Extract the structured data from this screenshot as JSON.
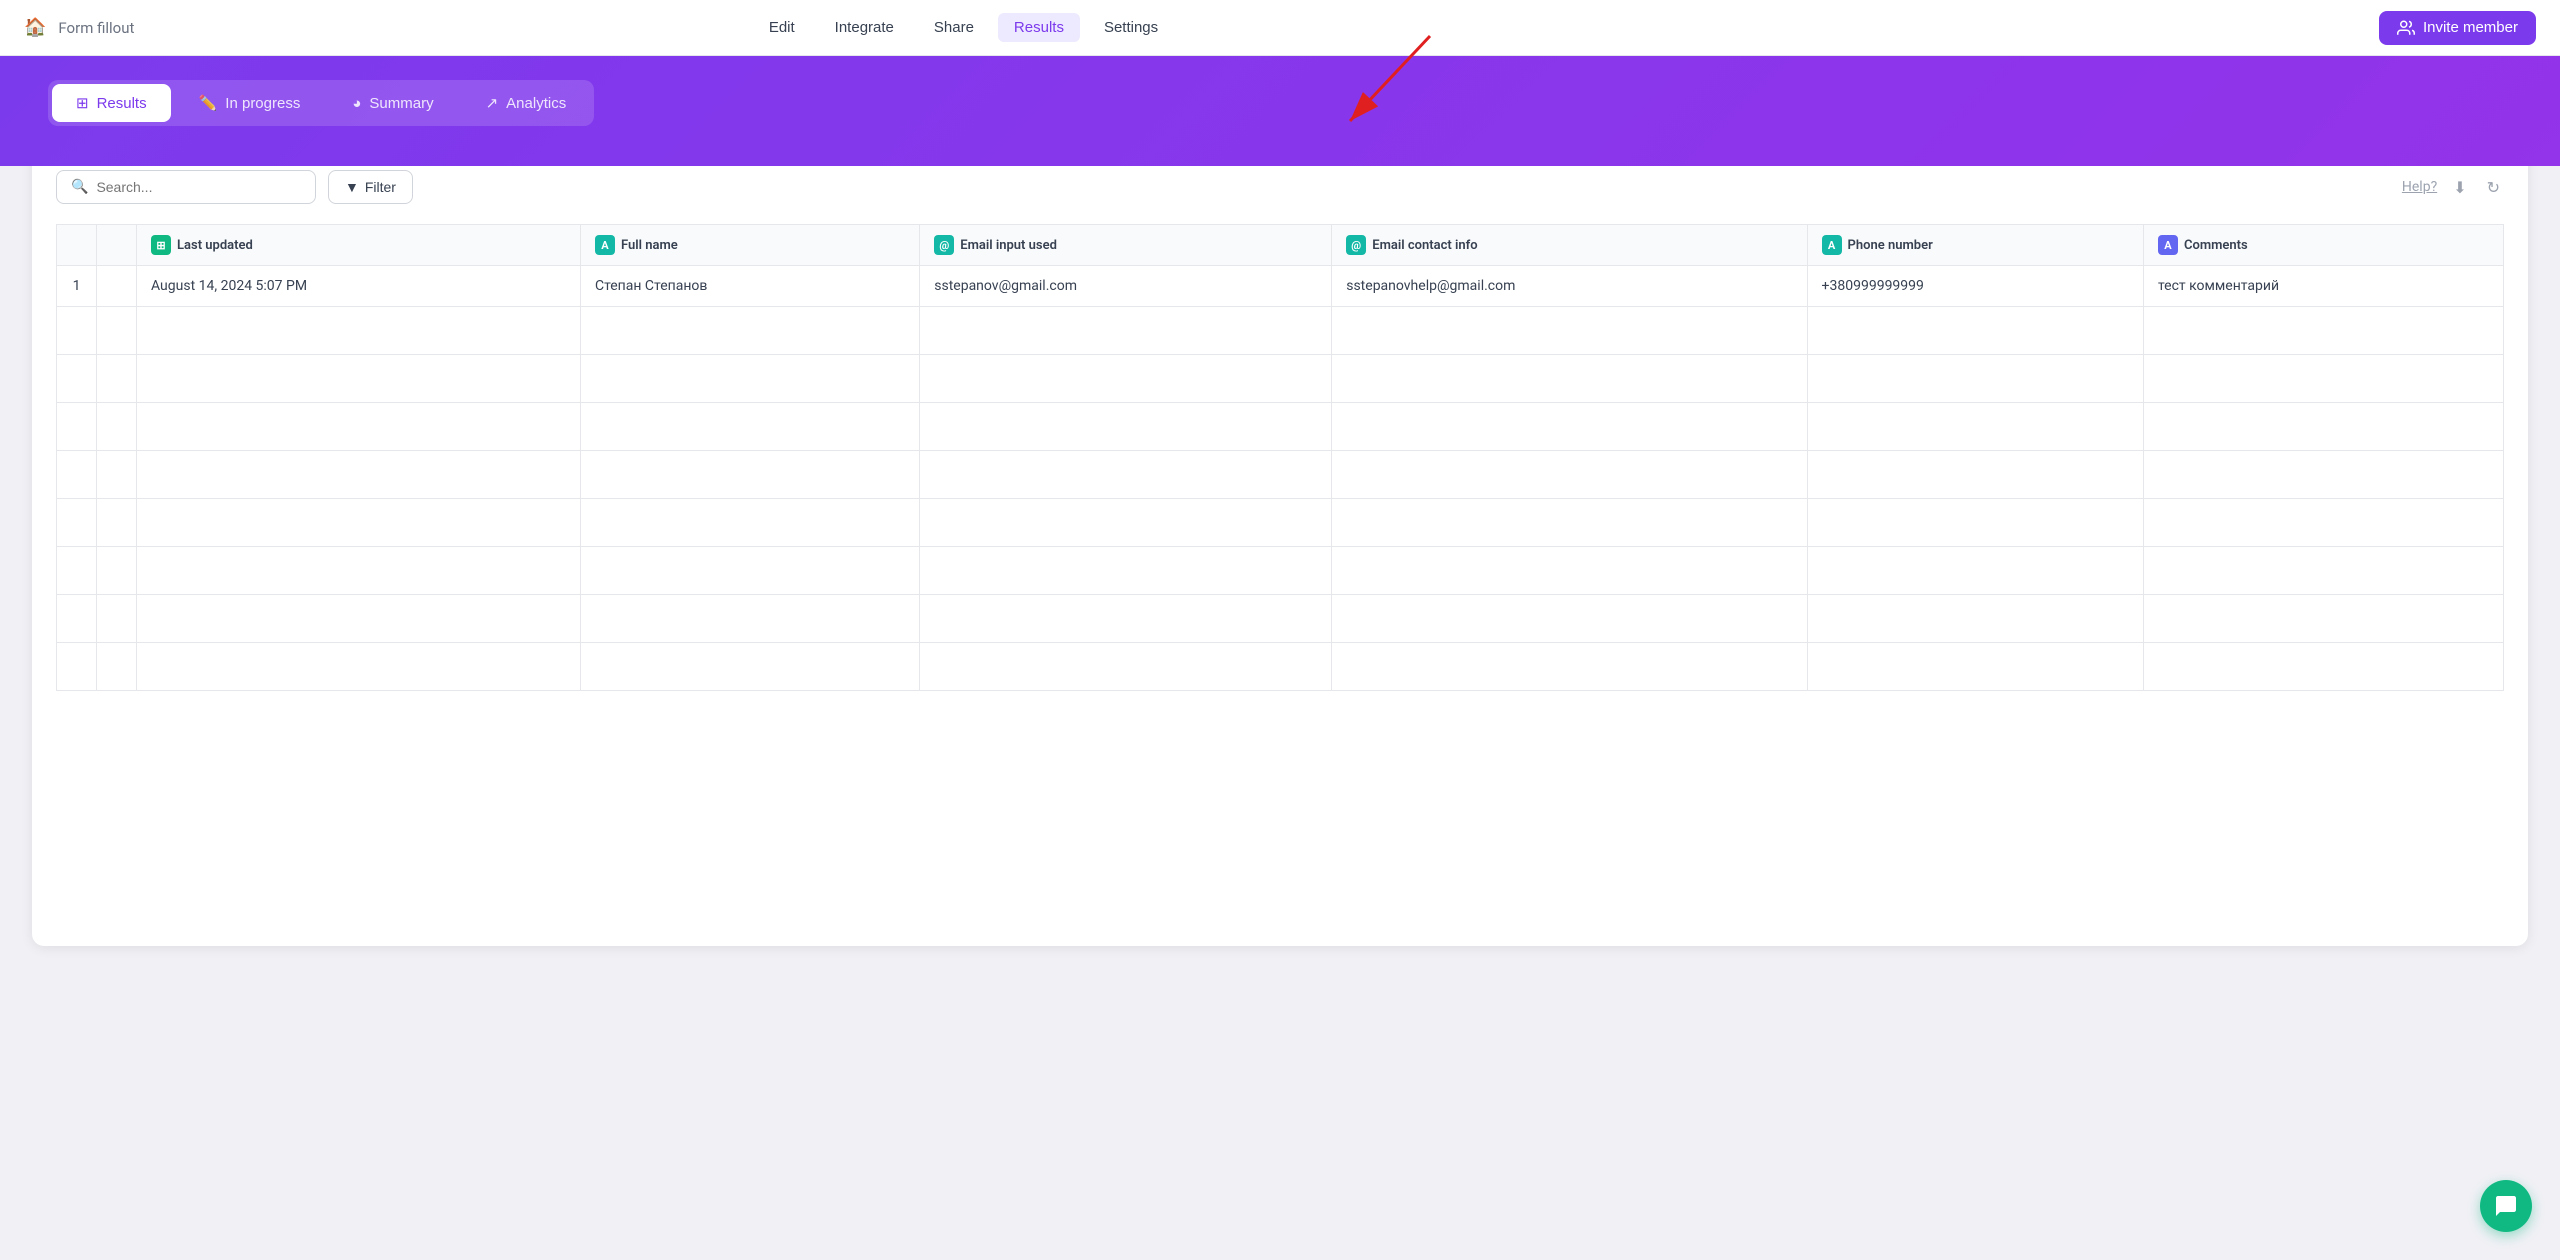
{
  "topNav": {
    "homeLabel": "🏠",
    "formTitle": "Form fillout",
    "links": [
      {
        "id": "edit",
        "label": "Edit",
        "active": false
      },
      {
        "id": "integrate",
        "label": "Integrate",
        "active": false
      },
      {
        "id": "share",
        "label": "Share",
        "active": false
      },
      {
        "id": "results",
        "label": "Results",
        "active": true
      },
      {
        "id": "settings",
        "label": "Settings",
        "active": false
      }
    ],
    "inviteButton": "Invite member"
  },
  "subTabs": [
    {
      "id": "results",
      "label": "Results",
      "icon": "⊞",
      "active": true
    },
    {
      "id": "inprogress",
      "label": "In progress",
      "icon": "✏️",
      "active": false
    },
    {
      "id": "summary",
      "label": "Summary",
      "icon": "◕",
      "active": false
    },
    {
      "id": "analytics",
      "label": "Analytics",
      "icon": "↗",
      "active": false
    }
  ],
  "toolbar": {
    "searchPlaceholder": "Search...",
    "filterLabel": "Filter",
    "helpLabel": "Help?"
  },
  "table": {
    "columns": [
      {
        "id": "num",
        "label": "",
        "icon": null,
        "iconType": null
      },
      {
        "id": "check",
        "label": "",
        "icon": null,
        "iconType": null
      },
      {
        "id": "last_updated",
        "label": "Last updated",
        "icon": "⊞",
        "iconType": "green"
      },
      {
        "id": "full_name",
        "label": "Full name",
        "icon": "A",
        "iconType": "teal"
      },
      {
        "id": "email_input",
        "label": "Email input used",
        "icon": "@",
        "iconType": "teal"
      },
      {
        "id": "email_contact",
        "label": "Email contact info",
        "icon": "@",
        "iconType": "teal"
      },
      {
        "id": "phone",
        "label": "Phone number",
        "icon": "A",
        "iconType": "teal"
      },
      {
        "id": "comments",
        "label": "Comments",
        "icon": "A",
        "iconType": "indigo"
      }
    ],
    "rows": [
      {
        "num": "1",
        "check": "",
        "last_updated": "August 14, 2024 5:07 PM",
        "full_name": "Степан Степанов",
        "email_input": "sstepanov@gmail.com",
        "email_contact": "sstepanovhelp@gmail.com",
        "phone": "+380999999999",
        "comments": "тест комментарий"
      }
    ]
  },
  "colors": {
    "purple": "#7c3aed",
    "green": "#10b981",
    "teal": "#14b8a6",
    "indigo": "#6366f1"
  }
}
